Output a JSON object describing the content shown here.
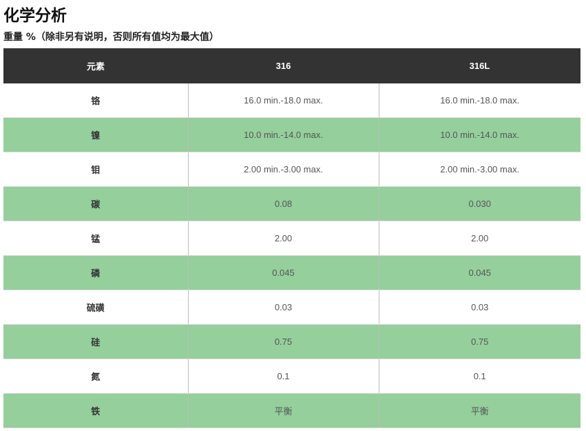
{
  "page": {
    "title": "化学分析",
    "subtitle": "重量 %（除非另有说明，否则所有值均为最大值）"
  },
  "table": {
    "headers": [
      "元素",
      "316",
      "316L"
    ],
    "rows": [
      {
        "element": "铬",
        "v316": "16.0 min.-18.0 max.",
        "v316L": "16.0 min.-18.0 max."
      },
      {
        "element": "镍",
        "v316": "10.0 min.-14.0 max.",
        "v316L": "10.0 min.-14.0 max."
      },
      {
        "element": "钼",
        "v316": "2.00 min.-3.00 max.",
        "v316L": "2.00 min.-3.00 max."
      },
      {
        "element": "碳",
        "v316": "0.08",
        "v316L": "0.030"
      },
      {
        "element": "锰",
        "v316": "2.00",
        "v316L": "2.00"
      },
      {
        "element": "磷",
        "v316": "0.045",
        "v316L": "0.045"
      },
      {
        "element": "硫磺",
        "v316": "0.03",
        "v316L": "0.03"
      },
      {
        "element": "硅",
        "v316": "0.75",
        "v316L": "0.75"
      },
      {
        "element": "氮",
        "v316": "0.1",
        "v316L": "0.1"
      },
      {
        "element": "铁",
        "v316": "平衡",
        "v316L": "平衡"
      }
    ]
  },
  "colors": {
    "header_background": "#333333",
    "header_text": "#ffffff",
    "striped_row": "#94cf9c",
    "plain_row": "#ffffff"
  }
}
